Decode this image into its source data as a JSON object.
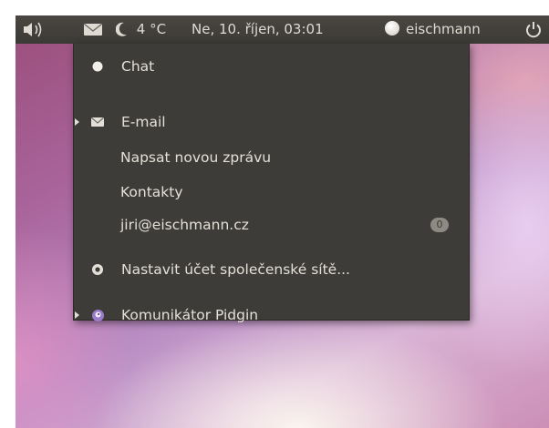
{
  "panel": {
    "weather": "4 °C",
    "clock": "Ne, 10. říjen, 03:01",
    "user": "eischmann"
  },
  "menu": {
    "chat": "Chat",
    "email": "E-mail",
    "new_message": "Napsat novou zprávu",
    "contacts": "Kontakty",
    "account": "jiri@eischmann.cz",
    "account_count": "0",
    "social": "Nastavit účet společenské sítě...",
    "pidgin": "Komunikátor Pidgin"
  },
  "icons": [
    "speaker-icon",
    "envelope-icon",
    "moon-icon",
    "user-avatar-icon",
    "power-icon",
    "chat-bubble-icon",
    "gwibber-icon",
    "pidgin-icon",
    "submenu-arrow-icon"
  ],
  "colors": {
    "panel_bg": "#3c3a36",
    "menu_bg": "#3e3c38",
    "menu_text": "#e4e0d8",
    "badge": "#8d8a84"
  }
}
